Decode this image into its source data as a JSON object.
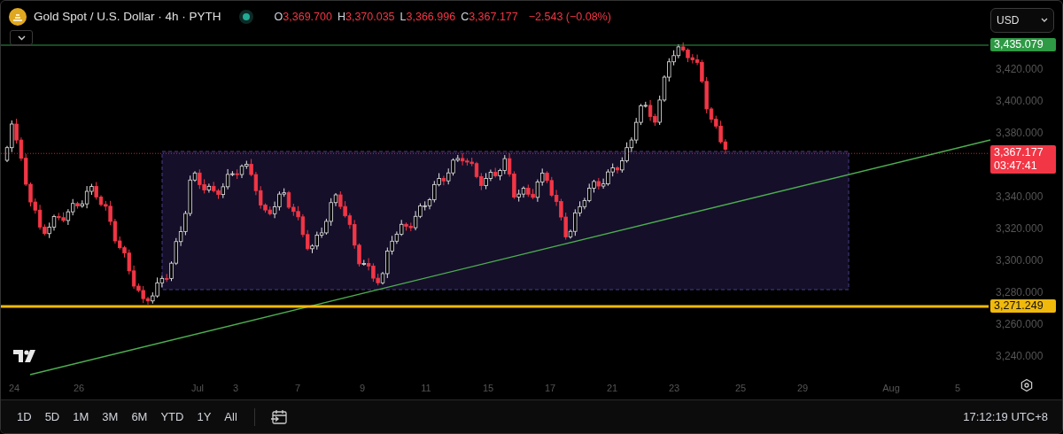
{
  "header": {
    "title": "Gold Spot / U.S. Dollar · 4h · PYTH",
    "ohlc": [
      {
        "label": "O",
        "value": "3,369.700"
      },
      {
        "label": "H",
        "value": "3,370.035"
      },
      {
        "label": "L",
        "value": "3,366.996"
      },
      {
        "label": "C",
        "value": "3,367.177"
      }
    ],
    "change": "−2.543 (−0.08%)"
  },
  "currency_select": {
    "value": "USD"
  },
  "price_axis": {
    "ticks": [
      "3,420.000",
      "3,400.000",
      "3,380.000",
      "3,340.000",
      "3,320.000",
      "3,300.000",
      "3,280.000",
      "3,260.000",
      "3,240.000"
    ]
  },
  "price_labels": [
    {
      "kind": "line",
      "price": "3,435.079",
      "color": "#2e9a45"
    },
    {
      "kind": "last",
      "price": "3,367.177",
      "countdown": "03:47:41",
      "color": "#f23645"
    },
    {
      "kind": "line",
      "price": "3,271.249",
      "color": "#f0b90b"
    }
  ],
  "time_axis": {
    "ticks": [
      "24",
      "26",
      "Jul",
      "3",
      "7",
      "9",
      "11",
      "15",
      "17",
      "21",
      "23",
      "25",
      "29",
      "Aug",
      "5"
    ]
  },
  "range_buttons": [
    "1D",
    "5D",
    "1M",
    "3M",
    "6M",
    "YTD",
    "1Y",
    "All"
  ],
  "clock": "17:12:19 UTC+8"
}
